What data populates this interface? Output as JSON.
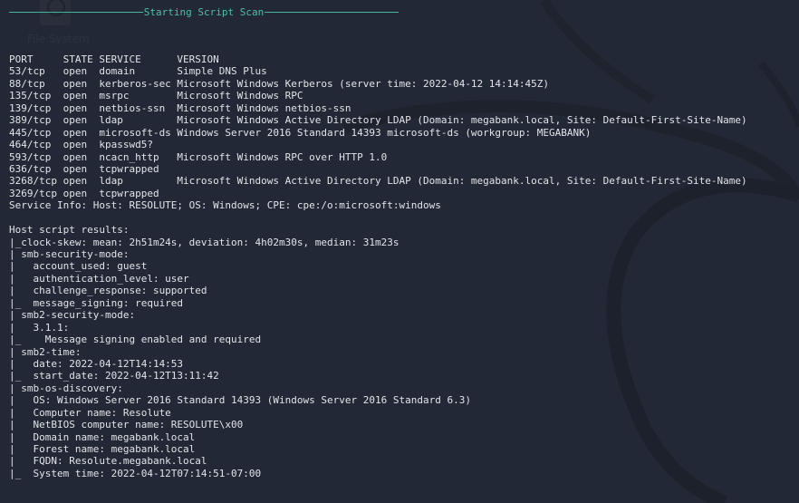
{
  "desktop": {
    "icon_label": "File System"
  },
  "colors": {
    "background": "#232836",
    "text": "#e2e4e8",
    "accent": "#4fbfa5"
  },
  "header": {
    "title": "Starting Script Scan"
  },
  "lines": [
    "PORT     STATE SERVICE      VERSION",
    "53/tcp   open  domain       Simple DNS Plus",
    "88/tcp   open  kerberos-sec Microsoft Windows Kerberos (server time: 2022-04-12 14:14:45Z)",
    "135/tcp  open  msrpc        Microsoft Windows RPC",
    "139/tcp  open  netbios-ssn  Microsoft Windows netbios-ssn",
    "389/tcp  open  ldap         Microsoft Windows Active Directory LDAP (Domain: megabank.local, Site: Default-First-Site-Name)",
    "445/tcp  open  microsoft-ds Windows Server 2016 Standard 14393 microsoft-ds (workgroup: MEGABANK)",
    "464/tcp  open  kpasswd5?",
    "593/tcp  open  ncacn_http   Microsoft Windows RPC over HTTP 1.0",
    "636/tcp  open  tcpwrapped",
    "3268/tcp open  ldap         Microsoft Windows Active Directory LDAP (Domain: megabank.local, Site: Default-First-Site-Name)",
    "3269/tcp open  tcpwrapped",
    "Service Info: Host: RESOLUTE; OS: Windows; CPE: cpe:/o:microsoft:windows",
    "",
    "Host script results:",
    "|_clock-skew: mean: 2h51m24s, deviation: 4h02m30s, median: 31m23s",
    "| smb-security-mode:",
    "|   account_used: guest",
    "|   authentication_level: user",
    "|   challenge_response: supported",
    "|_  message_signing: required",
    "| smb2-security-mode:",
    "|   3.1.1:",
    "|_    Message signing enabled and required",
    "| smb2-time:",
    "|   date: 2022-04-12T14:14:53",
    "|_  start_date: 2022-04-12T13:11:42",
    "| smb-os-discovery:",
    "|   OS: Windows Server 2016 Standard 14393 (Windows Server 2016 Standard 6.3)",
    "|   Computer name: Resolute",
    "|   NetBIOS computer name: RESOLUTE\\x00",
    "|   Domain name: megabank.local",
    "|   Forest name: megabank.local",
    "|   FQDN: Resolute.megabank.local",
    "|_  System time: 2022-04-12T07:14:51-07:00"
  ]
}
